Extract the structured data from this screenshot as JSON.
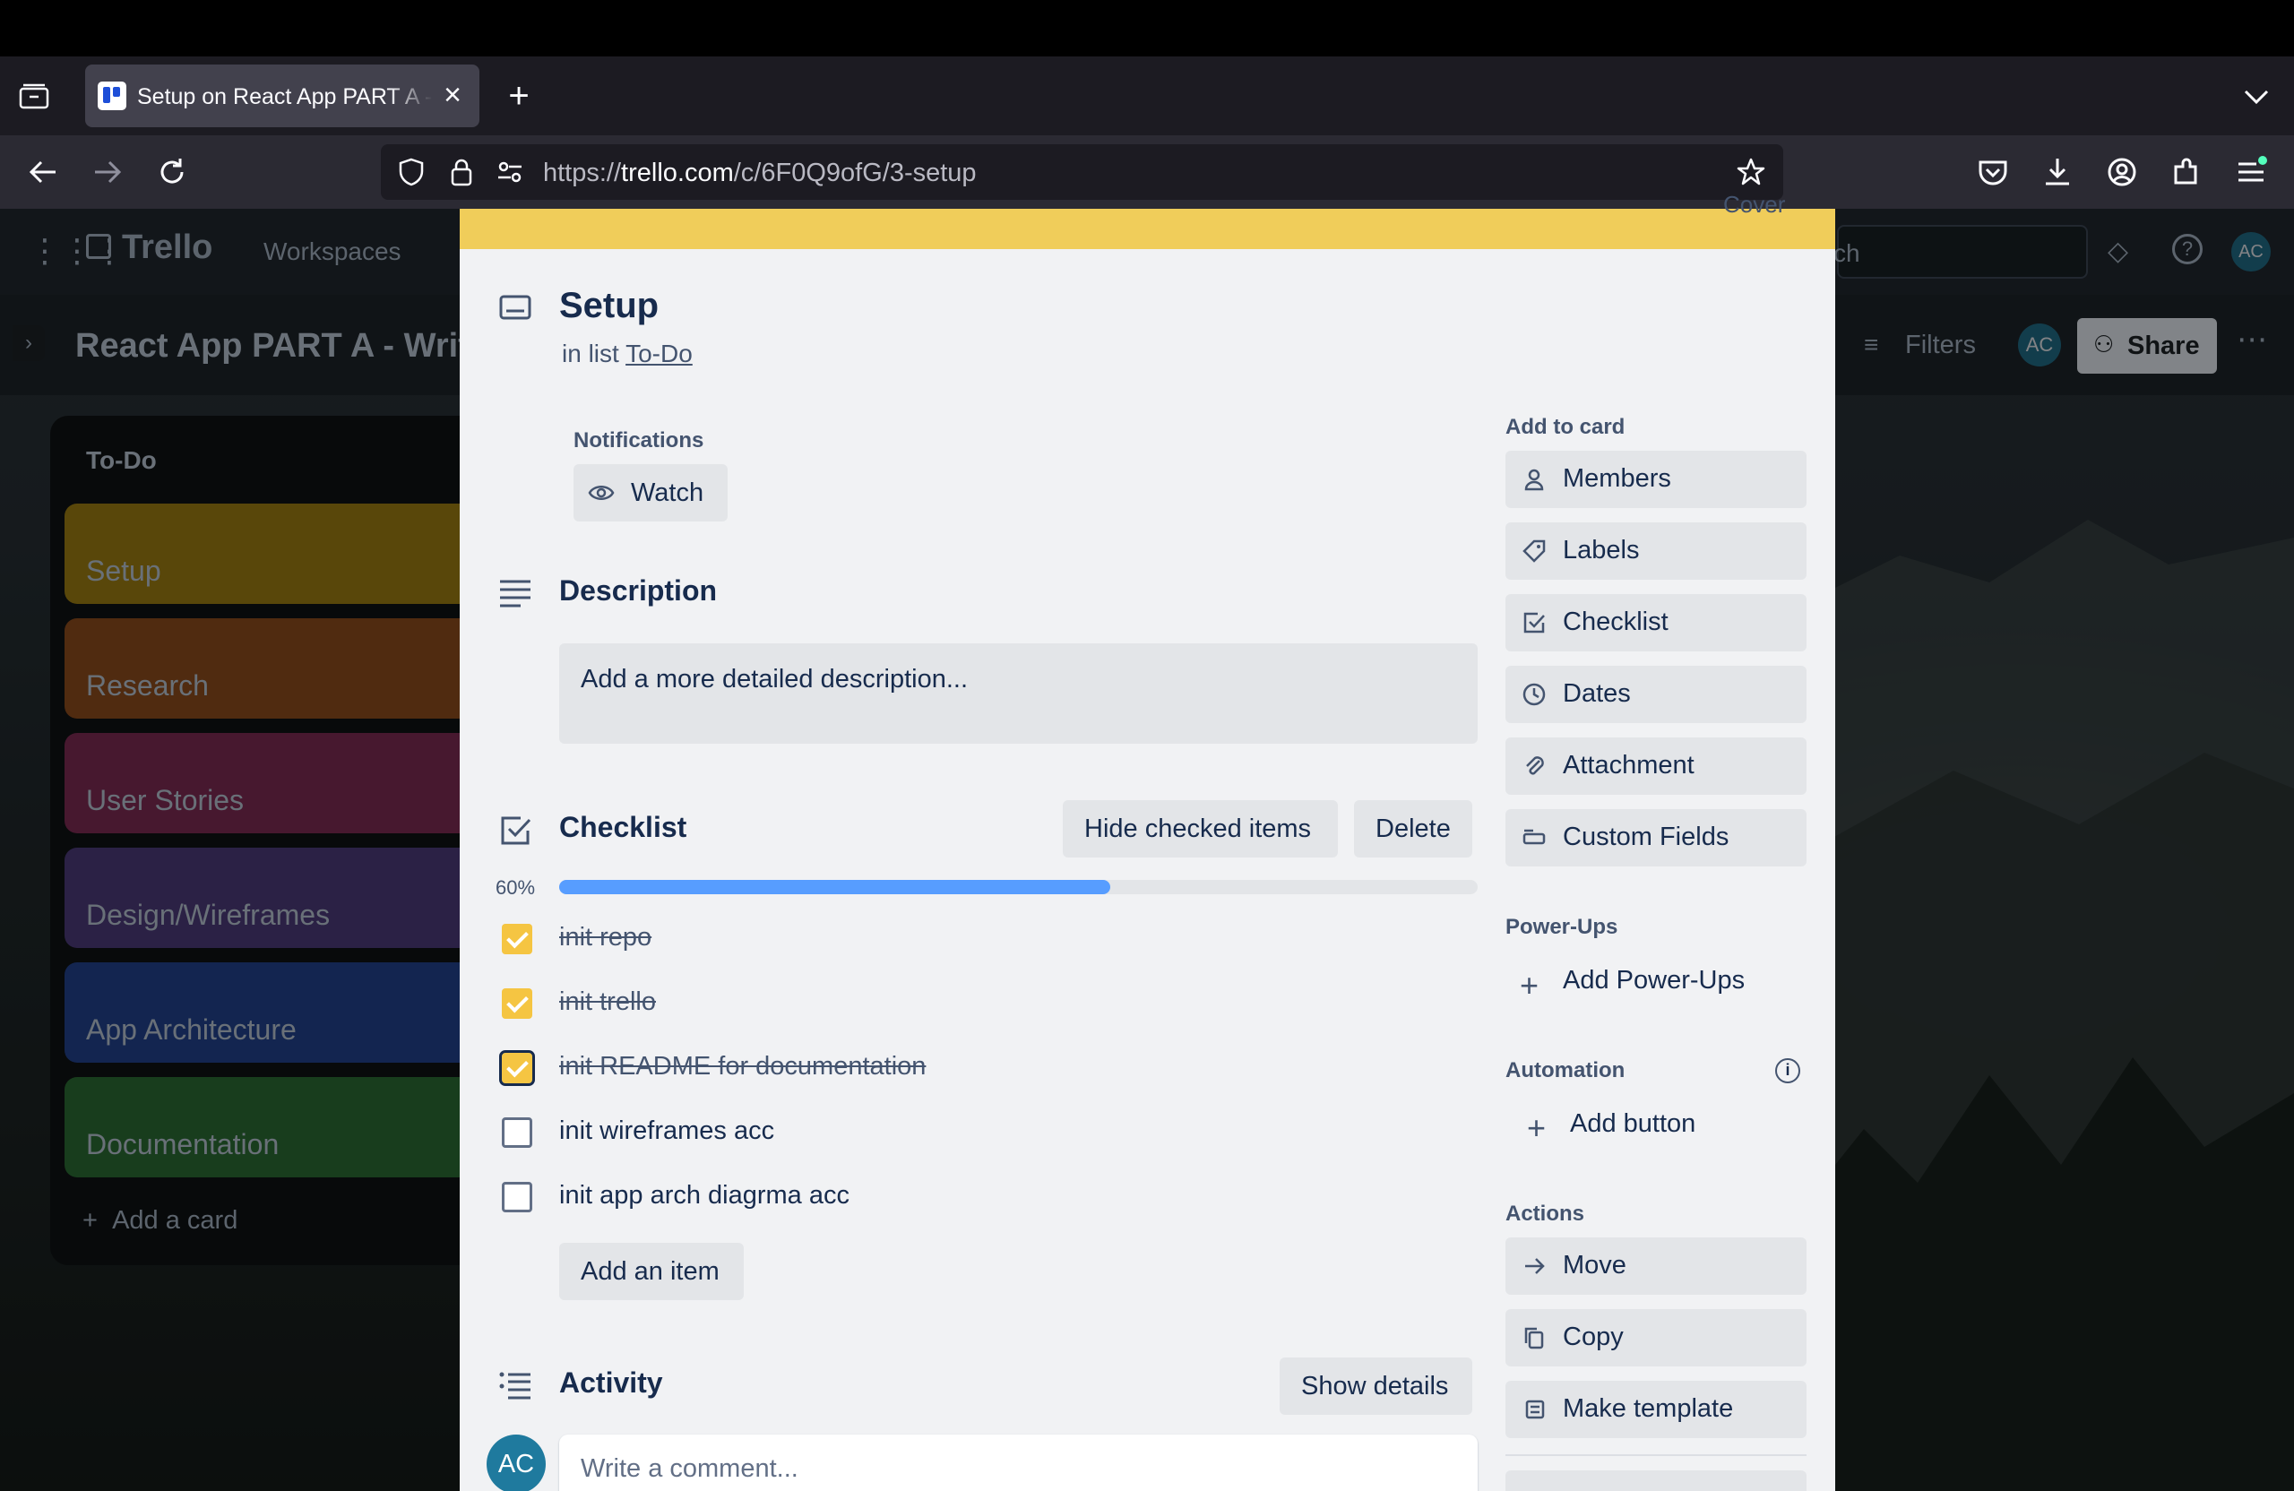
{
  "browser": {
    "tab_title": "Setup on React App PART A - Writ",
    "new_tab": "+",
    "close_tab": "×",
    "url_prefix": "https://",
    "url_host": "trello.com",
    "url_path": "/c/6F0Q9ofG/3-setup"
  },
  "trello": {
    "logo": "Trello",
    "workspaces": "Workspaces",
    "search": "ch",
    "board_title": "React App PART A - Writ",
    "filters": "Filters",
    "share": "Share",
    "member_avatar": "AC",
    "list": {
      "title": "To-Do",
      "cards": [
        {
          "label": "Setup",
          "color": "#9a7a12"
        },
        {
          "label": "Research",
          "color": "#8a4a1c"
        },
        {
          "label": "User Stories",
          "color": "#7a2a52"
        },
        {
          "label": "Design/Wireframes",
          "color": "#4a3a78"
        },
        {
          "label": "App Architecture",
          "color": "#21418a"
        },
        {
          "label": "Documentation",
          "color": "#2a6a33"
        }
      ],
      "add_card": "Add a card"
    }
  },
  "card": {
    "cover_label": "Cover",
    "cover_color": "#f0cd5a",
    "title": "Setup",
    "in_list_prefix": "in list",
    "list_name": "To-Do",
    "notifications_label": "Notifications",
    "watch_label": "Watch",
    "description_heading": "Description",
    "description_placeholder": "Add a more detailed description...",
    "checklist": {
      "heading": "Checklist",
      "hide_checked": "Hide checked items",
      "delete": "Delete",
      "progress_label": "60%",
      "progress": 0.6,
      "items": [
        {
          "text": "init repo",
          "checked": true
        },
        {
          "text": "init trello",
          "checked": true
        },
        {
          "text": "init README for documentation",
          "checked": true
        },
        {
          "text": "init wireframes acc",
          "checked": false
        },
        {
          "text": "init app arch diagrma acc",
          "checked": false
        }
      ],
      "add_item": "Add an item"
    },
    "activity": {
      "heading": "Activity",
      "show_details": "Show details",
      "avatar": "AC",
      "comment_placeholder": "Write a comment..."
    },
    "sidebar": {
      "add_to_card": "Add to card",
      "members": "Members",
      "labels": "Labels",
      "checklist": "Checklist",
      "dates": "Dates",
      "attachment": "Attachment",
      "custom_fields": "Custom Fields",
      "power_ups": "Power-Ups",
      "add_power_ups": "Add Power-Ups",
      "automation": "Automation",
      "add_button": "Add button",
      "actions": "Actions",
      "move": "Move",
      "copy": "Copy",
      "make_template": "Make template"
    }
  }
}
